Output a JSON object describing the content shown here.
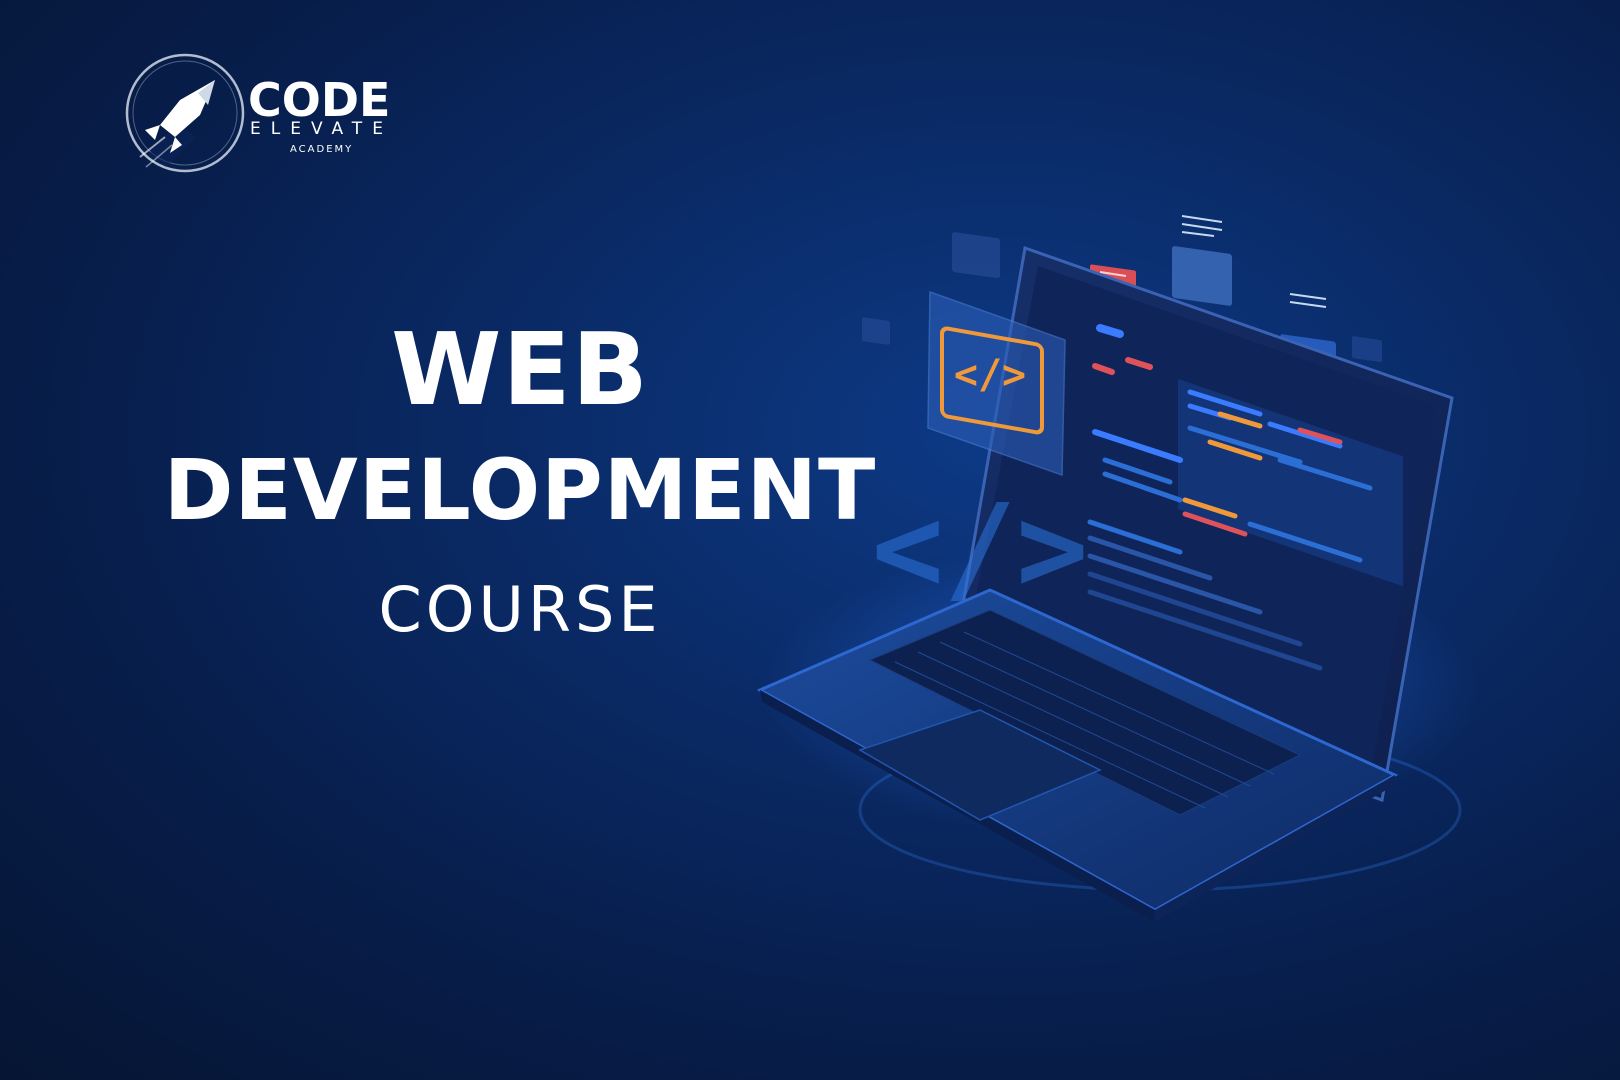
{
  "logo": {
    "word": "CODE",
    "sub": "ELEVATE",
    "tag": "ACADEMY",
    "icon": "rocket-icon"
  },
  "headline": {
    "line1": "WEB",
    "line2": "DEVELOPMENT",
    "line3": "COURSE"
  },
  "illustration": {
    "icon": "code-brackets-icon",
    "glyph": "</>"
  },
  "colors": {
    "background": "#0a2a66",
    "accent_orange": "#f0993a",
    "accent_red": "#e0525a",
    "screen_blue": "#2b6fd6"
  }
}
